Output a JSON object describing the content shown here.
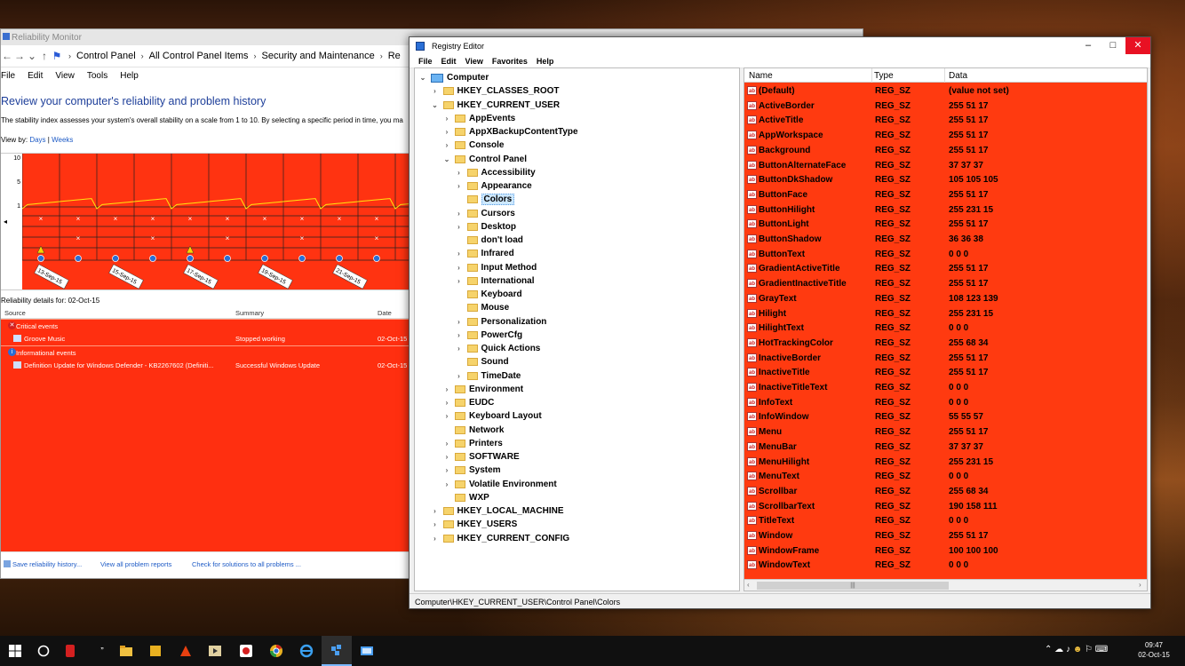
{
  "reliability_monitor": {
    "title": "Reliability Monitor",
    "breadcrumbs": [
      "Control Panel",
      "All Control Panel Items",
      "Security and Maintenance",
      "Re"
    ],
    "menu": [
      "File",
      "Edit",
      "View",
      "Tools",
      "Help"
    ],
    "heading": "Review your computer's reliability and problem history",
    "description": "The stability index assesses your system's overall stability on a scale from 1 to 10. By selecting a specific period in time, you ma",
    "view_by_label": "View by:",
    "view_days": "Days",
    "view_sep": "|",
    "view_weeks": "Weeks",
    "y_ticks": [
      "10",
      "5",
      "1"
    ],
    "date_labels": [
      "13-Sep-15",
      "15-Sep-15",
      "17-Sep-15",
      "19-Sep-15",
      "21-Sep-15"
    ],
    "details_label": "Reliability details for: 02-Oct-15",
    "columns": {
      "source": "Source",
      "summary": "Summary",
      "date": "Date"
    },
    "critical_label": "Critical events",
    "critical_rows": [
      {
        "source": "Groove Music",
        "summary": "Stopped working",
        "date": "02-Oct-15"
      }
    ],
    "info_label": "Informational events",
    "info_rows": [
      {
        "source": "Definition Update for Windows Defender - KB2267602 (Definiti...",
        "summary": "Successful Windows Update",
        "date": "02-Oct-15"
      }
    ],
    "footer_links": [
      "Save reliability history...",
      "View all problem reports",
      "Check for solutions to all problems ..."
    ]
  },
  "registry_editor": {
    "title": "Registry Editor",
    "window_buttons": {
      "minimize": "–",
      "maximize": "□",
      "close": "✕"
    },
    "menu": [
      "File",
      "Edit",
      "View",
      "Favorites",
      "Help"
    ],
    "tree": {
      "computer": "Computer",
      "hkcr": "HKEY_CLASSES_ROOT",
      "hkcu": "HKEY_CURRENT_USER",
      "hkcu_children": [
        "AppEvents",
        "AppXBackupContentType",
        "Console",
        "Control Panel"
      ],
      "control_panel_children": [
        "Accessibility",
        "Appearance",
        "Colors",
        "Cursors",
        "Desktop",
        "don't load",
        "Infrared",
        "Input Method",
        "International",
        "Keyboard",
        "Mouse",
        "Personalization",
        "PowerCfg",
        "Quick Actions",
        "Sound",
        "TimeDate"
      ],
      "hkcu_more": [
        "Environment",
        "EUDC",
        "Keyboard Layout",
        "Network",
        "Printers",
        "SOFTWARE",
        "System",
        "Volatile Environment",
        "WXP"
      ],
      "roots_more": [
        "HKEY_LOCAL_MACHINE",
        "HKEY_USERS",
        "HKEY_CURRENT_CONFIG"
      ]
    },
    "columns": {
      "name": "Name",
      "type": "Type",
      "data": "Data"
    },
    "values": [
      {
        "name": "(Default)",
        "type": "REG_SZ",
        "data": "(value not set)"
      },
      {
        "name": "ActiveBorder",
        "type": "REG_SZ",
        "data": "255 51 17"
      },
      {
        "name": "ActiveTitle",
        "type": "REG_SZ",
        "data": "255 51 17"
      },
      {
        "name": "AppWorkspace",
        "type": "REG_SZ",
        "data": "255 51 17"
      },
      {
        "name": "Background",
        "type": "REG_SZ",
        "data": "255 51 17"
      },
      {
        "name": "ButtonAlternateFace",
        "type": "REG_SZ",
        "data": "37 37 37"
      },
      {
        "name": "ButtonDkShadow",
        "type": "REG_SZ",
        "data": "105 105 105"
      },
      {
        "name": "ButtonFace",
        "type": "REG_SZ",
        "data": "255 51 17"
      },
      {
        "name": "ButtonHilight",
        "type": "REG_SZ",
        "data": "255 231 15"
      },
      {
        "name": "ButtonLight",
        "type": "REG_SZ",
        "data": "255 51 17"
      },
      {
        "name": "ButtonShadow",
        "type": "REG_SZ",
        "data": "36 36 38"
      },
      {
        "name": "ButtonText",
        "type": "REG_SZ",
        "data": "0 0 0"
      },
      {
        "name": "GradientActiveTitle",
        "type": "REG_SZ",
        "data": "255 51 17"
      },
      {
        "name": "GradientInactiveTitle",
        "type": "REG_SZ",
        "data": "255 51 17"
      },
      {
        "name": "GrayText",
        "type": "REG_SZ",
        "data": "108 123 139"
      },
      {
        "name": "Hilight",
        "type": "REG_SZ",
        "data": "255 231 15"
      },
      {
        "name": "HilightText",
        "type": "REG_SZ",
        "data": "0 0 0"
      },
      {
        "name": "HotTrackingColor",
        "type": "REG_SZ",
        "data": "255 68 34"
      },
      {
        "name": "InactiveBorder",
        "type": "REG_SZ",
        "data": "255 51 17"
      },
      {
        "name": "InactiveTitle",
        "type": "REG_SZ",
        "data": "255 51 17"
      },
      {
        "name": "InactiveTitleText",
        "type": "REG_SZ",
        "data": "0 0 0"
      },
      {
        "name": "InfoText",
        "type": "REG_SZ",
        "data": "0 0 0"
      },
      {
        "name": "InfoWindow",
        "type": "REG_SZ",
        "data": "55 55 57"
      },
      {
        "name": "Menu",
        "type": "REG_SZ",
        "data": "255 51 17"
      },
      {
        "name": "MenuBar",
        "type": "REG_SZ",
        "data": "37 37 37"
      },
      {
        "name": "MenuHilight",
        "type": "REG_SZ",
        "data": "255 231 15"
      },
      {
        "name": "MenuText",
        "type": "REG_SZ",
        "data": "0 0 0"
      },
      {
        "name": "Scrollbar",
        "type": "REG_SZ",
        "data": "255 68 34"
      },
      {
        "name": "ScrollbarText",
        "type": "REG_SZ",
        "data": "190 158 111"
      },
      {
        "name": "TitleText",
        "type": "REG_SZ",
        "data": "0 0 0"
      },
      {
        "name": "Window",
        "type": "REG_SZ",
        "data": "255 51 17"
      },
      {
        "name": "WindowFrame",
        "type": "REG_SZ",
        "data": "100 100 100"
      },
      {
        "name": "WindowText",
        "type": "REG_SZ",
        "data": "0 0 0"
      }
    ],
    "status_path": "Computer\\HKEY_CURRENT_USER\\Control Panel\\Colors"
  },
  "taskbar": {
    "icons": [
      "windows-start",
      "cortana-search",
      "app-red",
      "task-view",
      "file-explorer",
      "app-puzzle",
      "app-paint",
      "media-player",
      "app-record",
      "chrome",
      "internet-explorer",
      "regedit",
      "remote-desktop"
    ],
    "clock_time": "09:47",
    "clock_date": "02-Oct-15"
  },
  "colors": {
    "accent_red": "#ff3311",
    "chart_line": "#ffe70f",
    "link": "#1e5bc6"
  }
}
